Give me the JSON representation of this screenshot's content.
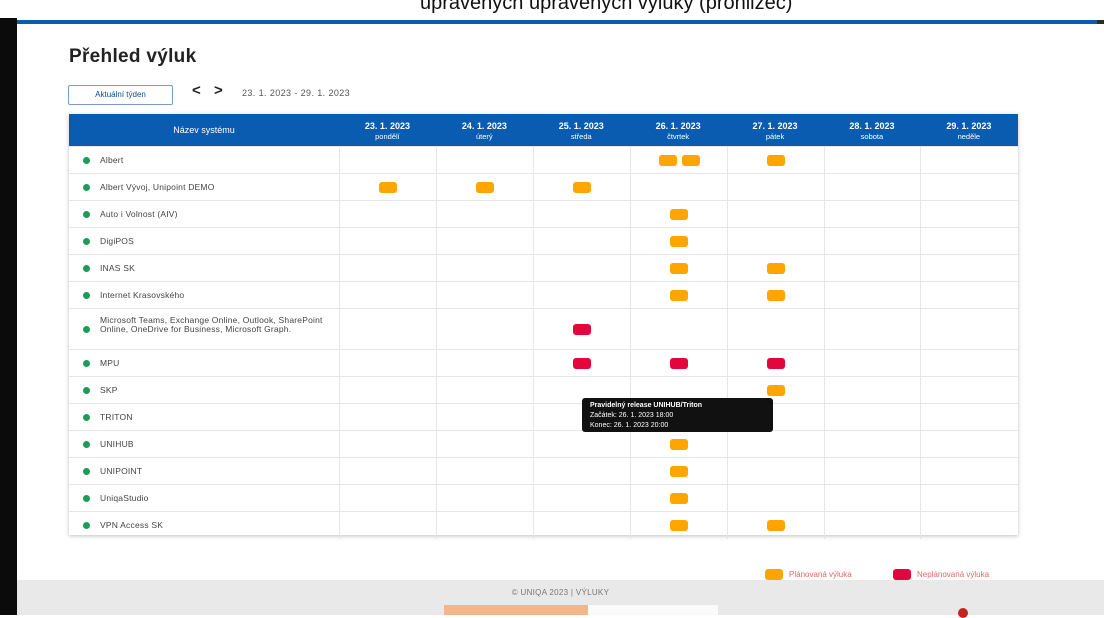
{
  "top_cut_text": "upravenych upravenych vyluky (prohlizec)",
  "page": {
    "title": "Přehled výluk"
  },
  "toolbar": {
    "current_week_label": "Aktuální týden",
    "prev_label": "<",
    "next_label": ">",
    "date_range": "23. 1. 2023 - 29. 1. 2023"
  },
  "table": {
    "name_header": "Název systému",
    "days": [
      {
        "date": "23. 1. 2023",
        "weekday": "pondělí"
      },
      {
        "date": "24. 1. 2023",
        "weekday": "úterý"
      },
      {
        "date": "25. 1. 2023",
        "weekday": "středa"
      },
      {
        "date": "26. 1. 2023",
        "weekday": "čtvrtek"
      },
      {
        "date": "27. 1. 2023",
        "weekday": "pátek"
      },
      {
        "date": "28. 1. 2023",
        "weekday": "sobota"
      },
      {
        "date": "29. 1. 2023",
        "weekday": "neděle"
      }
    ],
    "rows": [
      {
        "name": "Albert",
        "cells": [
          [],
          [],
          [],
          [
            "planned",
            "planned"
          ],
          [
            "planned"
          ],
          [],
          []
        ]
      },
      {
        "name": "Albert Vývoj, Unipoint DEMO",
        "cells": [
          [
            "planned"
          ],
          [
            "planned"
          ],
          [
            "planned"
          ],
          [],
          [],
          [],
          []
        ]
      },
      {
        "name": "Auto i Volnost (AIV)",
        "cells": [
          [],
          [],
          [],
          [
            "planned"
          ],
          [],
          [],
          []
        ]
      },
      {
        "name": "DigiPOS",
        "cells": [
          [],
          [],
          [],
          [
            "planned"
          ],
          [],
          [],
          []
        ]
      },
      {
        "name": "INAS SK",
        "cells": [
          [],
          [],
          [],
          [
            "planned"
          ],
          [
            "planned"
          ],
          [],
          []
        ]
      },
      {
        "name": "Internet Krasovského",
        "cells": [
          [],
          [],
          [],
          [
            "planned"
          ],
          [
            "planned"
          ],
          [],
          []
        ]
      },
      {
        "name": "Microsoft Teams, Exchange Online, Outlook, SharePoint Online, OneDrive for Business, Microsoft Graph.",
        "cells": [
          [],
          [],
          [
            "unplanned"
          ],
          [],
          [],
          [],
          []
        ]
      },
      {
        "name": "MPU",
        "cells": [
          [],
          [],
          [
            "unplanned"
          ],
          [
            "unplanned"
          ],
          [
            "unplanned"
          ],
          [],
          []
        ]
      },
      {
        "name": "SKP",
        "cells": [
          [],
          [],
          [],
          [],
          [
            "planned"
          ],
          [],
          []
        ]
      },
      {
        "name": "TRITON",
        "cells": [
          [],
          [],
          [],
          [
            "planned"
          ],
          [],
          [],
          []
        ]
      },
      {
        "name": "UNIHUB",
        "cells": [
          [],
          [],
          [],
          [
            "planned"
          ],
          [],
          [],
          []
        ]
      },
      {
        "name": "UNIPOINT",
        "cells": [
          [],
          [],
          [],
          [
            "planned"
          ],
          [],
          [],
          []
        ]
      },
      {
        "name": "UniqaStudio",
        "cells": [
          [],
          [],
          [],
          [
            "planned"
          ],
          [],
          [],
          []
        ]
      },
      {
        "name": "VPN Access SK",
        "cells": [
          [],
          [],
          [],
          [
            "planned"
          ],
          [
            "planned"
          ],
          [],
          []
        ]
      }
    ]
  },
  "tooltip": {
    "title": "Pravidelný release UNIHUB/Triton",
    "start": "Začátek: 26. 1. 2023 18:00",
    "end": "Konec: 26. 1. 2023 20:00"
  },
  "legend": {
    "planned": "Plánovaná výluka",
    "unplanned": "Neplánovaná výluka"
  },
  "colors": {
    "header_blue": "#0a5cb0",
    "planned": "#ffa500",
    "unplanned": "#e3063c",
    "status_green": "#1e9c55"
  },
  "footer": {
    "copyright": "© UNIQA 2023 | VÝLUKY"
  }
}
